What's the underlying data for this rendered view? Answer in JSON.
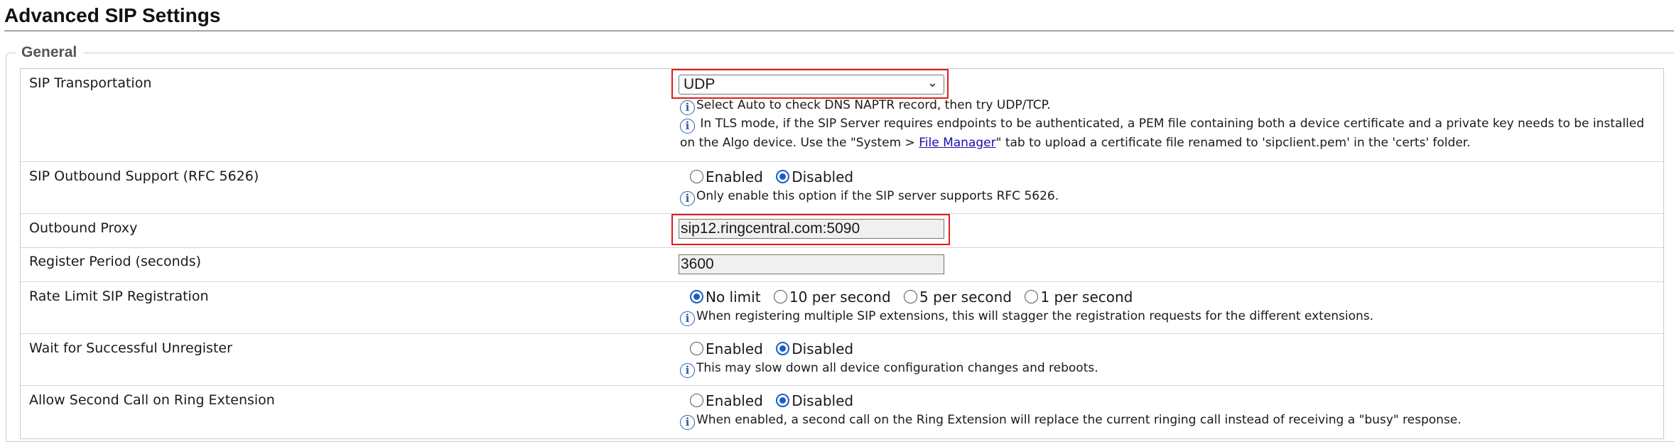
{
  "page_title": "Advanced SIP Settings",
  "section_legend": "General",
  "rows": {
    "sip_transport": {
      "label": "SIP Transportation",
      "value": "UDP",
      "help1": "Select Auto to check DNS NAPTR record, then try UDP/TCP.",
      "help2_pre": " In TLS mode, if the SIP Server requires endpoints to be authenticated, a PEM file containing both a device certificate and a private key needs to be installed on the Algo device. Use the \"System > ",
      "help2_link": "File Manager",
      "help2_post": "\" tab to upload a certificate file renamed to 'sipclient.pem' in the 'certs' folder."
    },
    "outbound_support": {
      "label": "SIP Outbound Support (RFC 5626)",
      "opt_enabled": "Enabled",
      "opt_disabled": "Disabled",
      "selected": "Disabled",
      "help": "Only enable this option if the SIP server supports RFC 5626."
    },
    "outbound_proxy": {
      "label": "Outbound Proxy",
      "value": "sip12.ringcentral.com:5090"
    },
    "register_period": {
      "label": "Register Period (seconds)",
      "value": "3600"
    },
    "rate_limit": {
      "label": "Rate Limit SIP Registration",
      "opt_nolimit": "No limit",
      "opt_10": "10 per second",
      "opt_5": "5 per second",
      "opt_1": "1 per second",
      "selected": "No limit",
      "help": "When registering multiple SIP extensions, this will stagger the registration requests for the different extensions."
    },
    "wait_unregister": {
      "label": "Wait for Successful Unregister",
      "opt_enabled": "Enabled",
      "opt_disabled": "Disabled",
      "selected": "Disabled",
      "help": "This may slow down all device configuration changes and reboots."
    },
    "second_call": {
      "label": "Allow Second Call on Ring Extension",
      "opt_enabled": "Enabled",
      "opt_disabled": "Disabled",
      "selected": "Disabled",
      "help": "When enabled, a second call on the Ring Extension will replace the current ringing call instead of receiving a \"busy\" response."
    }
  },
  "icons": {
    "info": "info-icon",
    "dropdown": "chevron-down-icon"
  },
  "colors": {
    "highlight": "#e01c1c",
    "link": "#1a0dab",
    "radio_selected": "#1a5fc0",
    "info_icon": "#2f5fa8"
  }
}
